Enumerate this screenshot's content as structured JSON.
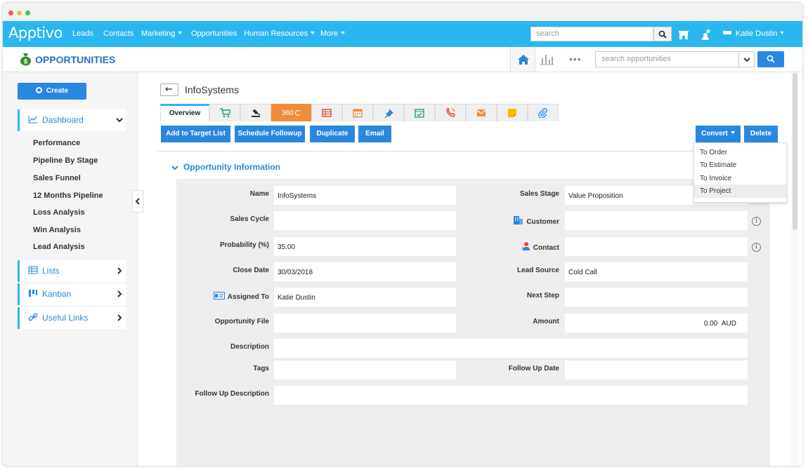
{
  "app": {
    "logo": "Apptivo",
    "nav": [
      {
        "label": "Leads",
        "dropdown": false
      },
      {
        "label": "Contacts",
        "dropdown": false
      },
      {
        "label": "Marketing",
        "dropdown": true
      },
      {
        "label": "Opportunities",
        "dropdown": false
      },
      {
        "label": "Human Resources",
        "dropdown": true
      },
      {
        "label": "More",
        "dropdown": true
      }
    ],
    "search_placeholder": "search",
    "user_name": "Katie Dustin"
  },
  "subheader": {
    "title": "OPPORTUNITIES",
    "search_placeholder": "search opportunities",
    "more": "•••"
  },
  "sidebar": {
    "create_label": "Create",
    "dashboard_label": "Dashboard",
    "dashboard_links": [
      "Performance",
      "Pipeline By Stage",
      "Sales Funnel",
      "12 Months Pipeline",
      "Loss Analysis",
      "Win Analysis",
      "Lead Analysis"
    ],
    "lists_label": "Lists",
    "kanban_label": "Kanban",
    "useful_links_label": "Useful Links"
  },
  "record": {
    "back_icon": "←",
    "title": "InfoSystems"
  },
  "tabs": {
    "overview": "Overview",
    "view360": "360"
  },
  "actions": {
    "add_to_target_list": "Add to Target List",
    "schedule_followup": "Schedule Followup",
    "duplicate": "Duplicate",
    "email": "Email",
    "convert": "Convert",
    "delete": "Delete"
  },
  "convert_menu": {
    "items": [
      "To Order",
      "To Estimate",
      "To Invoice",
      "To Project"
    ]
  },
  "section": {
    "title": "Opportunity Information"
  },
  "fields": {
    "name_label": "Name",
    "name_value": "InfoSystems",
    "sales_stage_label": "Sales Stage",
    "sales_stage_value": "Value Proposition",
    "sales_cycle_label": "Sales Cycle",
    "sales_cycle_value": "",
    "customer_label": "Customer",
    "customer_value": "",
    "probability_label": "Probability (%)",
    "probability_value": "35.00",
    "contact_label": "Contact",
    "contact_value": "",
    "close_date_label": "Close Date",
    "close_date_value": "30/03/2018",
    "lead_source_label": "Lead Source",
    "lead_source_value": "Cold Call",
    "assigned_to_label": "Assigned To",
    "assigned_to_value": "Katie Dustin",
    "next_step_label": "Next Step",
    "next_step_value": "",
    "opportunity_file_label": "Opportunity File",
    "amount_label": "Amount",
    "amount_value": "0.00",
    "amount_currency": "AUD",
    "description_label": "Description",
    "tags_label": "Tags",
    "follow_up_date_label": "Follow Up Date",
    "follow_up_description_label": "Follow Up Description",
    "info_glyph": "i"
  },
  "colors": {
    "topbar": "#2ab7ef",
    "primary_button": "#2a87e0",
    "tab_360": "#f08c3c"
  }
}
